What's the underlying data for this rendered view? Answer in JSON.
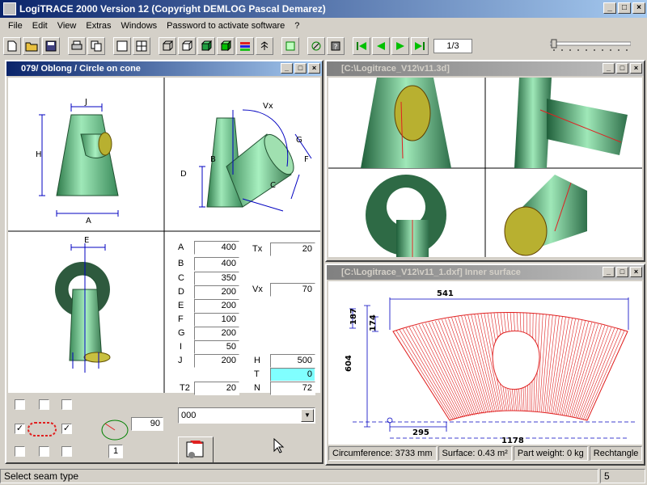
{
  "app": {
    "title": "LogiTRACE 2000  Version 12  (Copyright DEMLOG Pascal Demarez)"
  },
  "window_buttons": {
    "minimize": "_",
    "maximize": "□",
    "close": "×"
  },
  "menu": [
    "File",
    "Edit",
    "View",
    "Extras",
    "Windows",
    "Password to activate software",
    "?"
  ],
  "toolbar": {
    "page_indicator": "1/3"
  },
  "panels": {
    "params": {
      "title": "079/ Oblong / Circle on cone"
    },
    "view3d": {
      "title": "[C:\\Logitrace_V12\\v11.3d]"
    },
    "dxf": {
      "title": "[C:\\Logitrace_V12\\v11_1.dxf]  Inner surface"
    }
  },
  "dims": {
    "front": {
      "J": "J",
      "H": "H",
      "A": "A"
    },
    "side": {
      "Vx": "Vx",
      "G": "G",
      "F": "F",
      "B": "B",
      "D": "D",
      "C": "C"
    },
    "top": {
      "E": "E"
    }
  },
  "fields_left": [
    {
      "label": "A",
      "value": "400"
    },
    {
      "label": "B",
      "value": "400"
    },
    {
      "label": "C",
      "value": "350"
    },
    {
      "label": "D",
      "value": "200"
    },
    {
      "label": "E",
      "value": "200"
    },
    {
      "label": "F",
      "value": "100"
    },
    {
      "label": "G",
      "value": "200"
    },
    {
      "label": "I",
      "value": "50"
    },
    {
      "label": "J",
      "value": "200"
    }
  ],
  "fields_right": {
    "Tx": {
      "label": "Tx",
      "value": "20"
    },
    "Vx": {
      "label": "Vx",
      "value": "70"
    },
    "H": {
      "label": "H",
      "value": "500"
    },
    "T": {
      "label": "T",
      "value": "0"
    },
    "N": {
      "label": "N",
      "value": "72"
    },
    "T2": {
      "label": "T2",
      "value": "20"
    }
  },
  "seam": {
    "angle": "90",
    "count": "1",
    "combo_value": "000"
  },
  "dxf_dims": {
    "d541": "541",
    "d187": "187",
    "d174": "174",
    "d604": "604",
    "d295": "295",
    "d1178": "1178"
  },
  "info": {
    "circumference": "Circumference: 3733 mm",
    "surface": "Surface: 0.43 m²",
    "weight": "Part weight: 0 kg",
    "shape": "Rechtangle"
  },
  "status": {
    "message": "Select seam type",
    "number": "5"
  },
  "colors": {
    "active_title": "#0a246a",
    "cone": "#6fcf8f",
    "dim": "#0000c0",
    "dxf_lines": "#d02020"
  }
}
